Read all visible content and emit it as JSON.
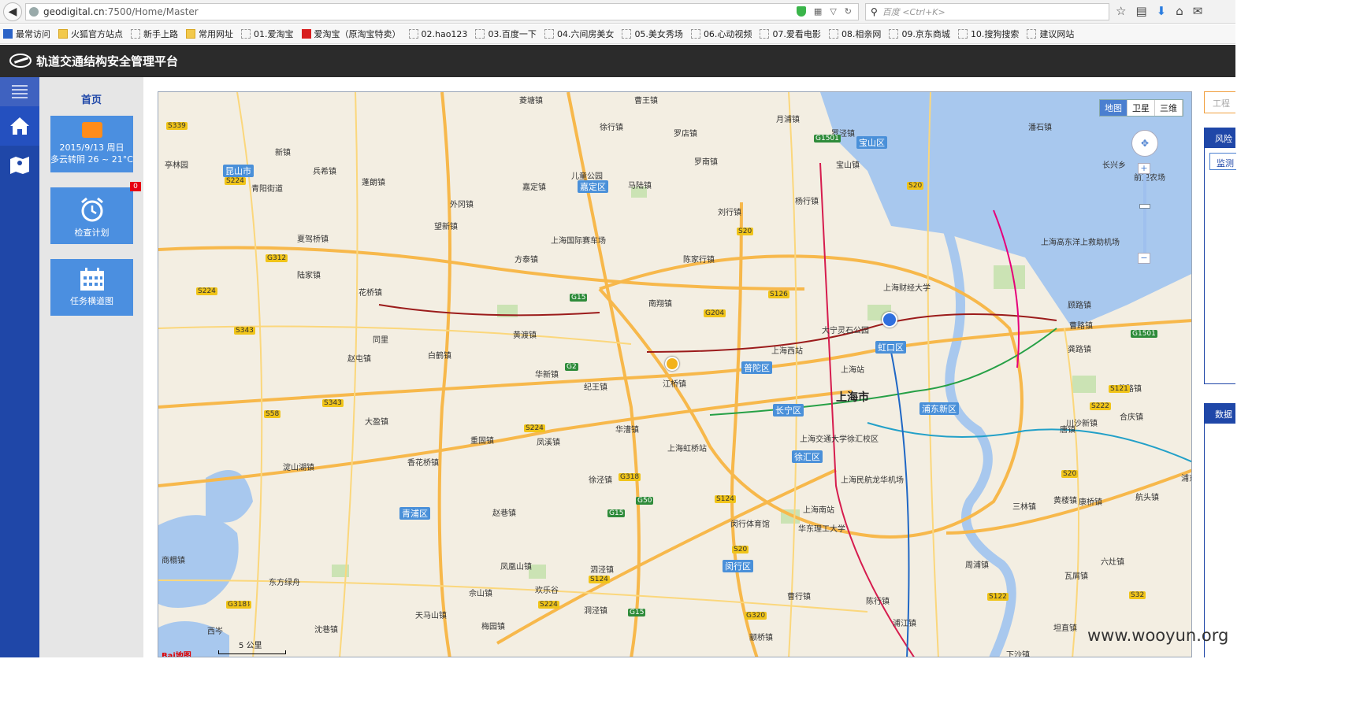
{
  "browser": {
    "url_host": "geodigital.cn",
    "url_path": ":7500/Home/Master",
    "search_placeholder": "百度 <Ctrl+K>",
    "bookmarks": [
      "最常访问",
      "火狐官方站点",
      "新手上路",
      "常用网址",
      "01.爱淘宝",
      "爱淘宝（原淘宝特卖）",
      "02.hao123",
      "03.百度一下",
      "04.六间房美女",
      "05.美女秀场",
      "06.心动视频",
      "07.爱看电影",
      "08.相亲网",
      "09.京东商城",
      "10.搜狗搜索",
      "建议网站"
    ]
  },
  "app": {
    "title": "轨道交通结构安全管理平台"
  },
  "sidepanel": {
    "home_label": "首页",
    "weather": {
      "date": "2015/9/13 周日",
      "desc": "多云转阴 26 ~ 21°C"
    },
    "plan": {
      "label": "检查计划",
      "badge": "0"
    },
    "tasks": {
      "label": "任务横道图"
    }
  },
  "map": {
    "types": [
      "地图",
      "卫星",
      "三维"
    ],
    "active_type": "地图",
    "scale_label": "5 公里",
    "brand": "Bai地图",
    "city": "上海市",
    "districts": [
      {
        "name": "昆山市"
      },
      {
        "name": "嘉定区"
      },
      {
        "name": "宝山区"
      },
      {
        "name": "普陀区"
      },
      {
        "name": "虹口区"
      },
      {
        "name": "长宁区"
      },
      {
        "name": "浦东新区"
      },
      {
        "name": "徐汇区"
      },
      {
        "name": "青浦区"
      },
      {
        "name": "闵行区"
      }
    ],
    "places": [
      "菱塘镇",
      "曹王镇",
      "月浦镇",
      "徐行镇",
      "罗店镇",
      "罗泾镇",
      "亭林园",
      "新镇",
      "兵希镇",
      "青阳街道",
      "蓬朗镇",
      "儿童公园",
      "马陆镇",
      "嘉定镇",
      "外冈镇",
      "罗南镇",
      "杨行镇",
      "刘行镇",
      "宝山镇",
      "望新镇",
      "上海国际赛车场",
      "陈家行镇",
      "夏驾桥镇",
      "陆家镇",
      "花桥镇",
      "方泰镇",
      "南翔镇",
      "上海财经大学",
      "大宁灵石公园",
      "上海西站",
      "上海站",
      "黄渡镇",
      "同里",
      "白鹤镇",
      "华新镇",
      "纪王镇",
      "江桥镇",
      "赵屯镇",
      "大盈镇",
      "重固镇",
      "凤溪镇",
      "华漕镇",
      "上海虹桥站",
      "上海交通大学徐汇校区",
      "淀山湖镇",
      "香花桥镇",
      "徐泾镇",
      "上海民航龙华机场",
      "上海南站",
      "华东理工大学",
      "闵行体育馆",
      "赵巷镇",
      "凤凰山镇",
      "泗泾镇",
      "欢乐谷",
      "佘山镇",
      "天马山镇",
      "洞泾镇",
      "东方绿舟",
      "沈巷镇",
      "西岑",
      "商榻镇",
      "梅园镇",
      "曹行镇",
      "陈行镇",
      "浦江镇",
      "颛桥镇",
      "周浦镇",
      "六灶镇",
      "瓦屑镇",
      "康桥镇",
      "三林镇",
      "下沙镇",
      "坦直镇",
      "唐镇",
      "川沙新镇",
      "合庆镇",
      "蔡路镇",
      "曹路镇",
      "顾路镇",
      "龚路镇",
      "潘石镇",
      "长兴乡",
      "前卫农场",
      "上海高东洋上救助机场",
      "黄楼镇",
      "航头镇",
      "浦东"
    ],
    "roads_g": [
      "G1501",
      "G1501",
      "G15",
      "G2",
      "G50",
      "G15",
      "G15"
    ],
    "roads_s": [
      "S339",
      "S224",
      "S224",
      "S343",
      "S343",
      "S58",
      "S312",
      "G312",
      "S20",
      "S20",
      "S126",
      "G204",
      "S224",
      "S124",
      "G318",
      "S20",
      "G318",
      "S121",
      "S222",
      "S20",
      "S32",
      "S122",
      "S124",
      "G320",
      "S224",
      "G318"
    ]
  },
  "rightpanel": {
    "project_placeholder": "工程",
    "risk_header": "风险",
    "risk_tab": "监测",
    "data_header": "数据"
  },
  "watermark": "www.wooyun.org",
  "colors": {
    "rail_blue": "#1f47a8",
    "tile_blue": "#4b8fe0",
    "header_dark": "#2b2b2b",
    "map_land": "#f3eee2",
    "map_water": "#a8c8ee"
  }
}
